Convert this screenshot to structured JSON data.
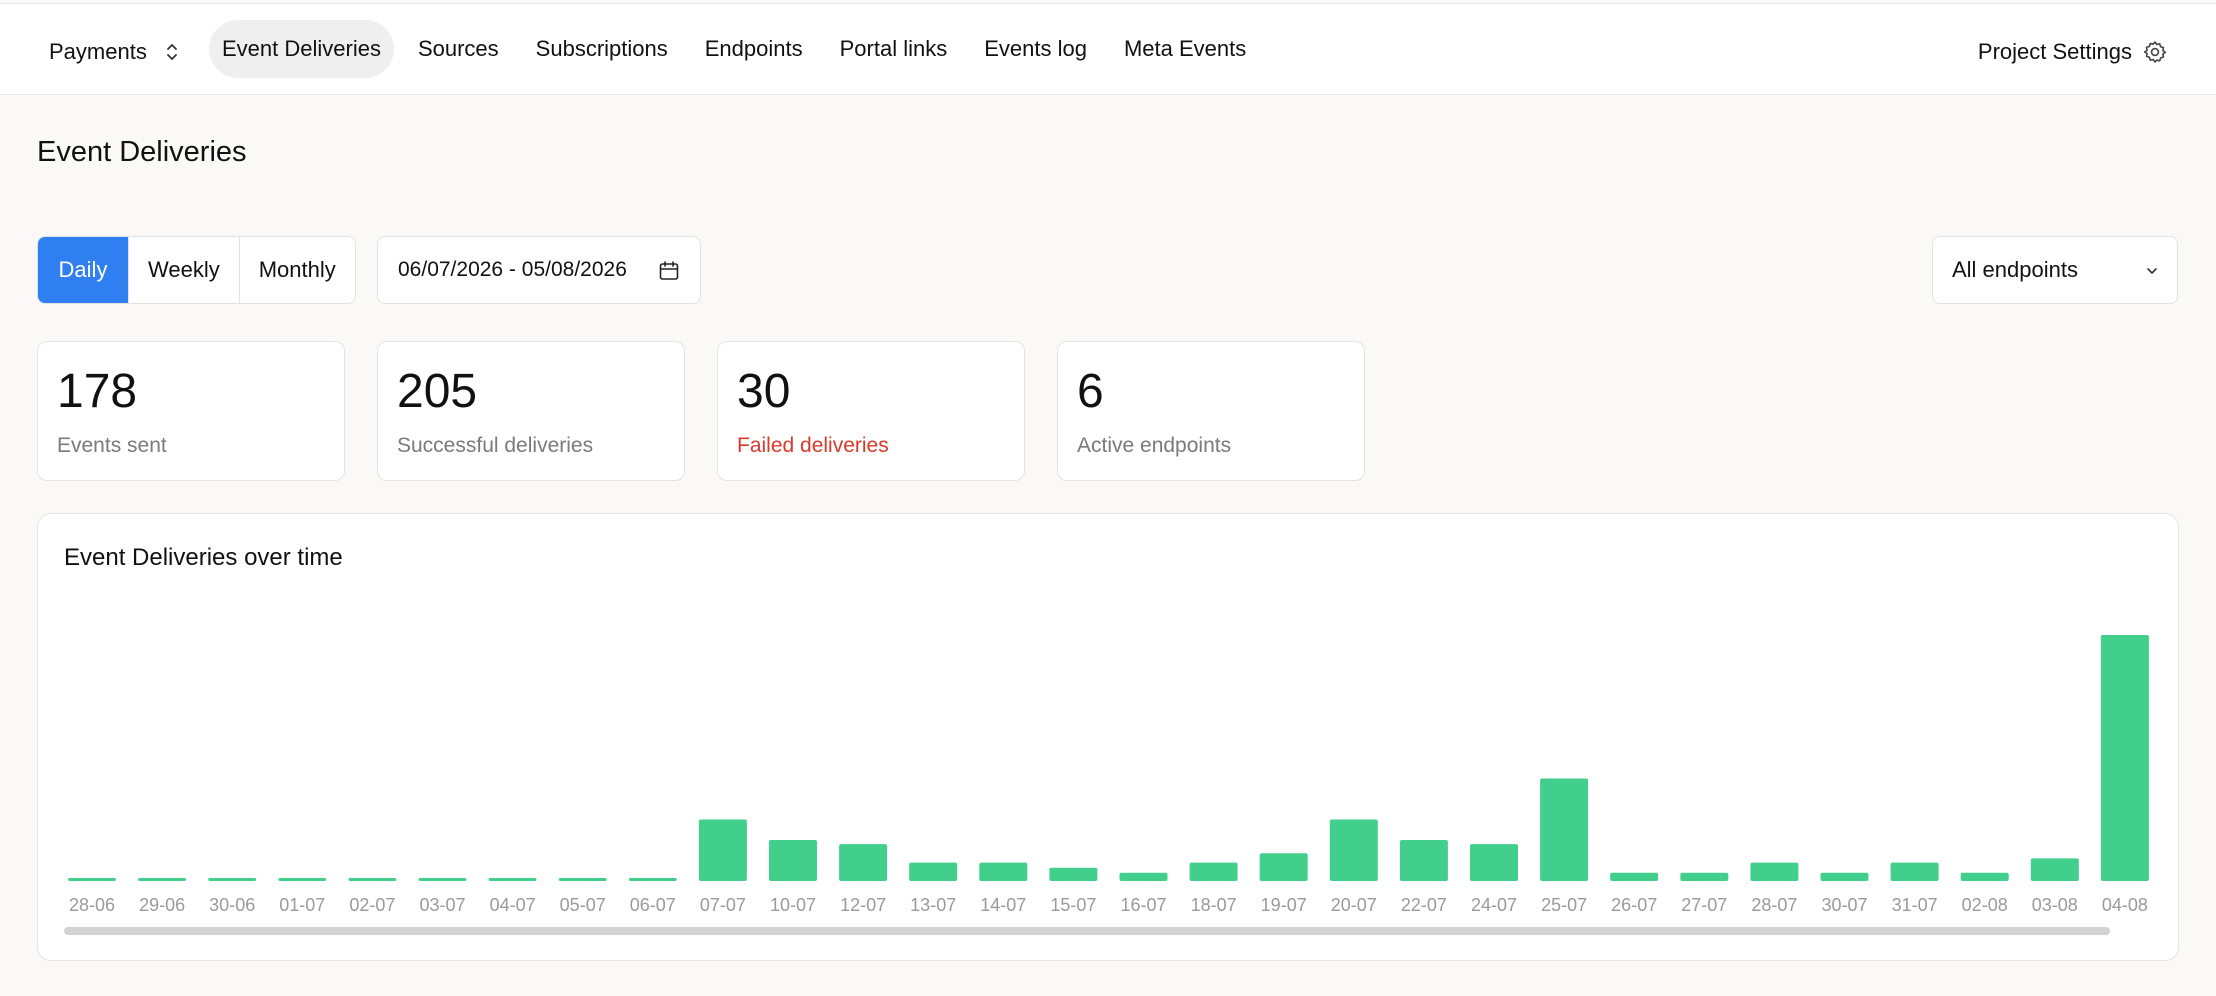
{
  "topbar": {
    "project": "Payments",
    "nav": [
      {
        "label": "Event Deliveries",
        "active": true
      },
      {
        "label": "Sources",
        "active": false
      },
      {
        "label": "Subscriptions",
        "active": false
      },
      {
        "label": "Endpoints",
        "active": false
      },
      {
        "label": "Portal links",
        "active": false
      },
      {
        "label": "Events log",
        "active": false
      },
      {
        "label": "Meta Events",
        "active": false
      }
    ],
    "settings_label": "Project Settings"
  },
  "page": {
    "title": "Event Deliveries"
  },
  "filters": {
    "periods": [
      "Daily",
      "Weekly",
      "Monthly"
    ],
    "active_period": "Daily",
    "date_range": "06/07/2026 - 05/08/2026",
    "endpoint_filter": "All endpoints"
  },
  "stats": [
    {
      "value": "178",
      "label": "Events sent"
    },
    {
      "value": "205",
      "label": "Successful deliveries"
    },
    {
      "value": "30",
      "label": "Failed deliveries",
      "status": "danger"
    },
    {
      "value": "6",
      "label": "Active endpoints"
    }
  ],
  "colors": {
    "accent": "#2f7ff0",
    "bar": "#42cf8b",
    "danger": "#d93a2b"
  },
  "chart_data": {
    "type": "bar",
    "title": "Event Deliveries over time",
    "categories": [
      "28-06",
      "29-06",
      "30-06",
      "01-07",
      "02-07",
      "03-07",
      "04-07",
      "05-07",
      "06-07",
      "07-07",
      "10-07",
      "12-07",
      "13-07",
      "14-07",
      "15-07",
      "16-07",
      "18-07",
      "19-07",
      "20-07",
      "22-07",
      "24-07",
      "25-07",
      "26-07",
      "27-07",
      "28-07",
      "30-07",
      "31-07",
      "02-08",
      "03-08",
      "04-08"
    ],
    "values": [
      0.2,
      0.2,
      0.2,
      0.2,
      0.2,
      0.2,
      0.2,
      0.2,
      0.2,
      6,
      4,
      3.6,
      1.8,
      1.8,
      1.3,
      0.8,
      1.8,
      2.7,
      6,
      4,
      3.6,
      10,
      0.8,
      0.8,
      1.8,
      0.8,
      1.8,
      0.8,
      2.2,
      24
    ],
    "ylim": [
      0,
      24
    ],
    "grid": false,
    "legend": "none"
  }
}
